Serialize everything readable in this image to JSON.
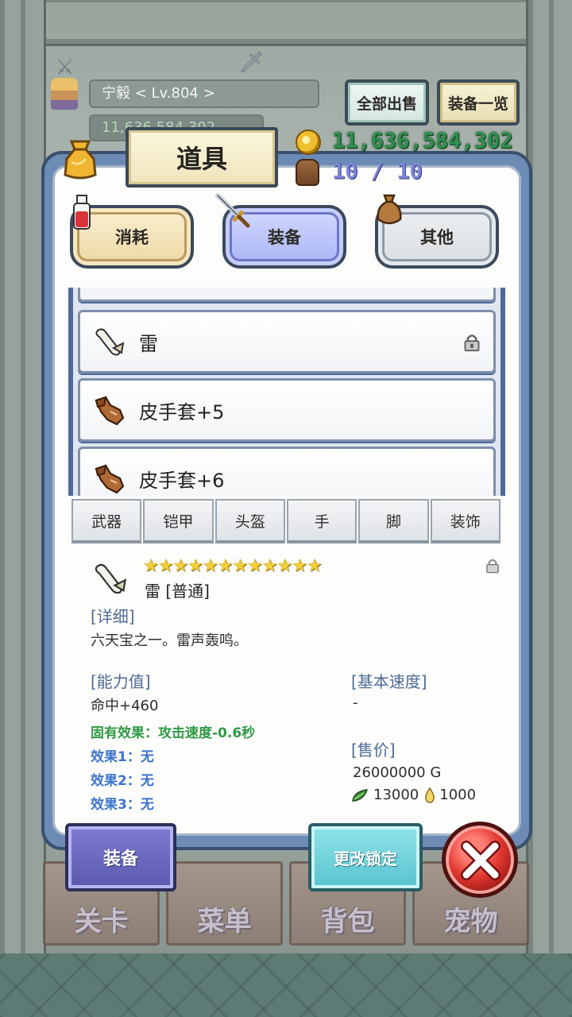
{
  "player": {
    "name_level": "宁毅    < Lv.804 >",
    "gold_partial": "11,636,584,302"
  },
  "top_buttons": {
    "sell_all": "全部出售",
    "equipment_list": "装备一览"
  },
  "panel": {
    "title": "道具",
    "gold": "11,636,584,302",
    "capacity": "10 / 10"
  },
  "category_tabs": [
    {
      "label": "消耗",
      "icon": "potion-icon"
    },
    {
      "label": "装备",
      "icon": "sword-icon",
      "active": true
    },
    {
      "label": "其他",
      "icon": "pouch-icon"
    }
  ],
  "items": [
    {
      "name": "雷",
      "icon": "scroll-icon",
      "locked": true
    },
    {
      "name": "皮手套+5",
      "icon": "glove-icon",
      "locked": false
    },
    {
      "name": "皮手套+6",
      "icon": "glove-icon",
      "locked": false
    }
  ],
  "filter_tabs": [
    "武器",
    "铠甲",
    "头盔",
    "手",
    "脚",
    "装饰"
  ],
  "detail": {
    "stars": "★★★★★★★★★★★★",
    "star_count": 12,
    "name": "雷 [普通]",
    "detail_header": "[详细]",
    "description": "六天宝之一。雷声轰鸣。",
    "stats_header": "[能力值]",
    "stat_line": "命中+460",
    "inherent_effect": "固有效果：攻击速度-0.6秒",
    "effect1": "效果1：无",
    "effect2": "效果2：无",
    "effect3": "效果3：无",
    "speed_header": "[基本速度]",
    "speed_value": "-",
    "price_header": "[售价]",
    "price_gold": "26000000 G",
    "price_leaf": "13000",
    "price_drop": "1000"
  },
  "action_buttons": {
    "equip": "装备",
    "change_lock": "更改锁定"
  },
  "bottom_nav": [
    "关卡",
    "菜单",
    "背包",
    "宠物"
  ],
  "colors": {
    "gold_text": "#2f8f4e",
    "capacity_text": "#7f86d8",
    "section_header": "#4d6c96",
    "inherent_effect": "#2f9a45",
    "effect": "#3c74cf",
    "star": "#f2cf38"
  }
}
